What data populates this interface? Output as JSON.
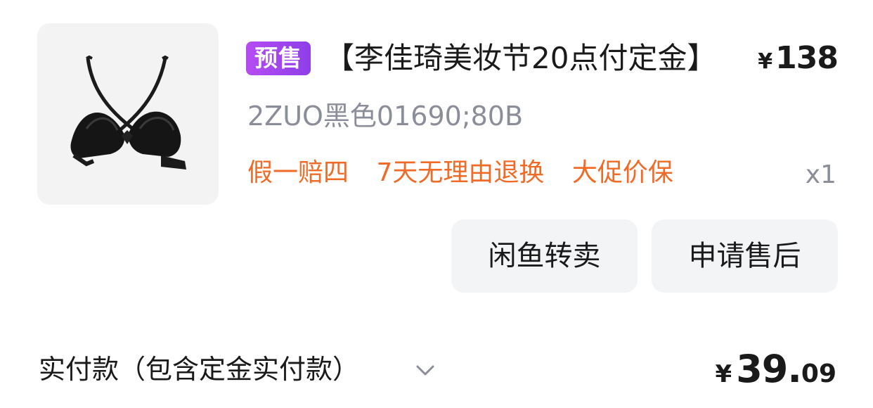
{
  "product": {
    "image_icon": "bra-product-image",
    "badge": "预售",
    "title": "【李佳琦美妆节20点付定金】",
    "price_currency": "¥",
    "price_value": "138",
    "sku": "2ZUO黑色01690;80B",
    "services": [
      "假一赔四",
      "7天无理由退换",
      "大促价保"
    ],
    "quantity": "x1"
  },
  "actions": {
    "xianyu_label": "闲鱼转卖",
    "aftersale_label": "申请售后"
  },
  "payment": {
    "label": "实付款（包含定金实付款）",
    "expand_icon": "chevron-down-icon",
    "currency": "¥",
    "amount_int": "39.",
    "amount_dec": "09"
  },
  "colors": {
    "badge_gradient_start": "#b54cf2",
    "badge_gradient_end": "#8e3fe8",
    "service_orange": "#f06b27",
    "muted_gray": "#8b8e99",
    "button_bg": "#f3f4f6"
  }
}
